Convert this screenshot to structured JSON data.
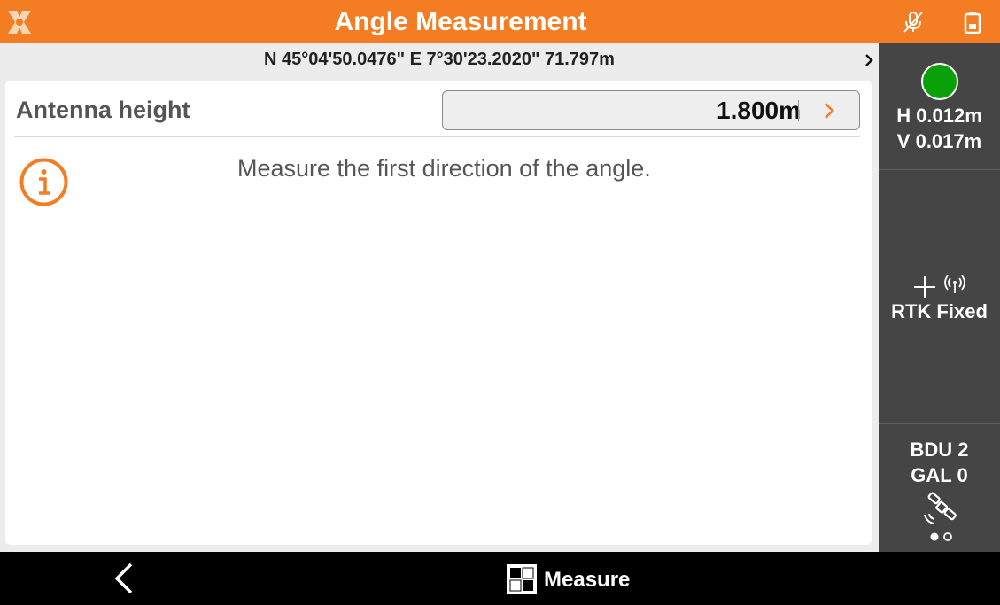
{
  "header": {
    "title": "Angle Measurement",
    "logo_icon": "app-logo-icon",
    "mic_icon": "mic-off-icon",
    "battery_icon": "battery-icon",
    "accent_color": "#f47c22"
  },
  "coordinates": {
    "text": "N 45°04'50.0476\" E 7°30'23.2020\" 71.797m",
    "expand_icon": "chevron-right-icon"
  },
  "form": {
    "antenna_label": "Antenna height",
    "antenna_value": "1.800m"
  },
  "message": {
    "icon": "info-icon",
    "text": "Measure the first direction of the angle."
  },
  "status": {
    "fix_color": "#0aa00a",
    "h_precision": "H 0.012m",
    "v_precision": "V 0.017m",
    "solution": "RTK Fixed",
    "constellation_1": "BDU 2",
    "constellation_2": "GAL 0",
    "page_index": 1,
    "page_count": 2
  },
  "bottom": {
    "back_icon": "back-chevron-icon",
    "measure_label": "Measure"
  }
}
